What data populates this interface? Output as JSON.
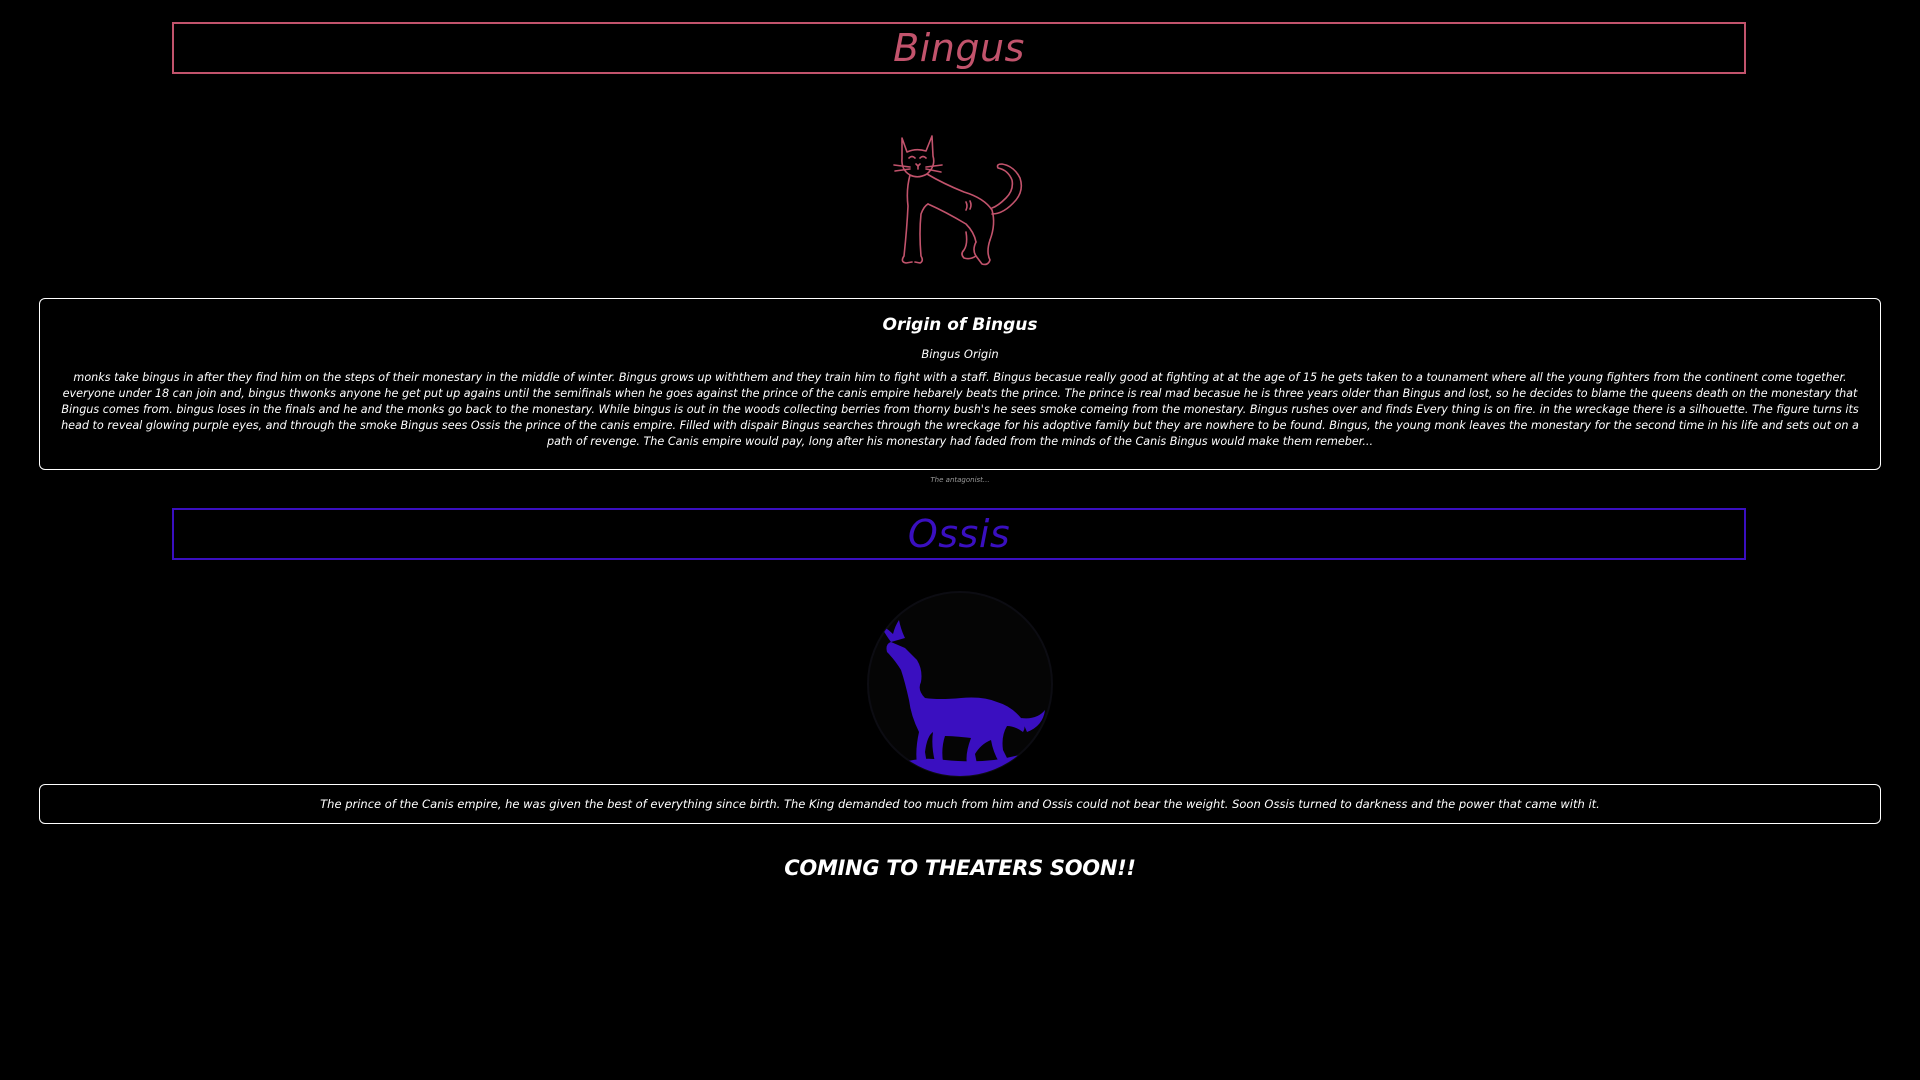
{
  "bingus_section": {
    "title": "Bingus",
    "image_icon": "cat-outline-icon",
    "card": {
      "heading": "Origin of Bingus",
      "subheading": "Bingus Origin",
      "body": "monks take bingus in after they find him on the steps of their monestary in the middle of winter. Bingus grows up withthem and they train him to fight with a staff. Bingus becasue really good at fighting at at the age of 15 he gets taken to a tounament where all the young fighters from the continent come together. everyone under 18 can join and, bingus thwonks anyone he get put up agains until the semifinals when he goes against the prince of the canis empire hebarely beats the prince. The prince is real mad becasue he is three years older than Bingus and lost, so he decides to blame the queens death on the monestary that Bingus comes from. bingus loses in the finals and he and the monks go back to the monestary. While bingus is out in the woods collecting berries from thorny bush's he sees smoke comeing from the monestary. Bingus rushes over and finds Every thing is on fire. in the wreckage there is a silhouette. The figure turns its head to reveal glowing purple eyes, and through the smoke Bingus sees Ossis the prince of the canis empire. Filled with dispair Bingus searches through the wreckage for his adoptive family but they are nowhere to be found. Bingus, the young monk leaves the monestary for the second time in his life and sets out on a path of revenge. The Canis empire would pay, long after his monestary had faded from the minds of the Canis Bingus would make them remeber..."
    }
  },
  "teaser": "The antagonist...",
  "ossis_section": {
    "title": "Ossis",
    "image_icon": "howling-wolf-icon",
    "card": {
      "body": "The prince of the Canis empire, he was given the best of everything since birth. The King demanded too much from him and Ossis could not bear the weight. Soon Ossis turned to darkness and the power that came with it."
    }
  },
  "footer": {
    "announcement": "COMING TO THEATERS SOON!!"
  },
  "colors": {
    "background": "#000000",
    "bingus_accent": "#c2536c",
    "ossis_accent": "#3a0fc0",
    "text": "#ffffff"
  }
}
